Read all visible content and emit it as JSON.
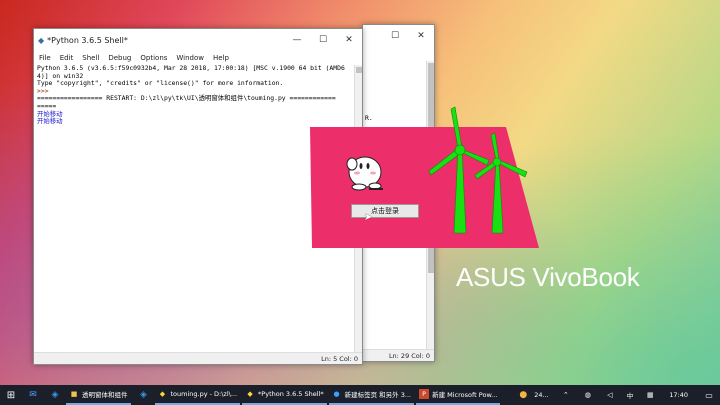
{
  "shell": {
    "title": "*Python 3.6.5 Shell*",
    "menu": [
      "File",
      "Edit",
      "Shell",
      "Debug",
      "Options",
      "Window",
      "Help"
    ],
    "lines": [
      "Python 3.6.5 (v3.6.5:f59c0932b4, Mar 28 2018, 17:00:18) [MSC v.1900 64 bit (AMD6",
      "4)] on win32",
      "Type \"copyright\", \"credits\" or \"license()\" for more information.",
      ">>> ",
      "================= RESTART: D:\\zl\\py\\tk\\UI\\透明窗体和组件\\touming.py ============",
      "====="
    ],
    "output": [
      "开始移动",
      "开始移动"
    ],
    "status": "Ln: 5  Col: 0"
  },
  "editor": {
    "visible_text": "R.",
    "status": "Ln: 29  Col: 0"
  },
  "app": {
    "button_label": "点击登录"
  },
  "brand": {
    "text": "ASUS VivoBook"
  },
  "taskbar": {
    "apps": [
      {
        "label": "透明窗体和组件",
        "icon": "folder-icon"
      },
      {
        "label": "touming.py - D:\\zl\\...",
        "icon": "python-file-icon"
      },
      {
        "label": "*Python 3.6.5 Shell*",
        "icon": "python-icon"
      },
      {
        "label": "新建标签页 和另外 3...",
        "icon": "edge-icon"
      },
      {
        "label": "新建 Microsoft Pow...",
        "icon": "powerpoint-icon"
      }
    ],
    "weather": "24...",
    "ime": "中",
    "time": "17:40"
  },
  "colors": {
    "app_bg": "#ec2f6a",
    "turbine": "#19e013"
  }
}
